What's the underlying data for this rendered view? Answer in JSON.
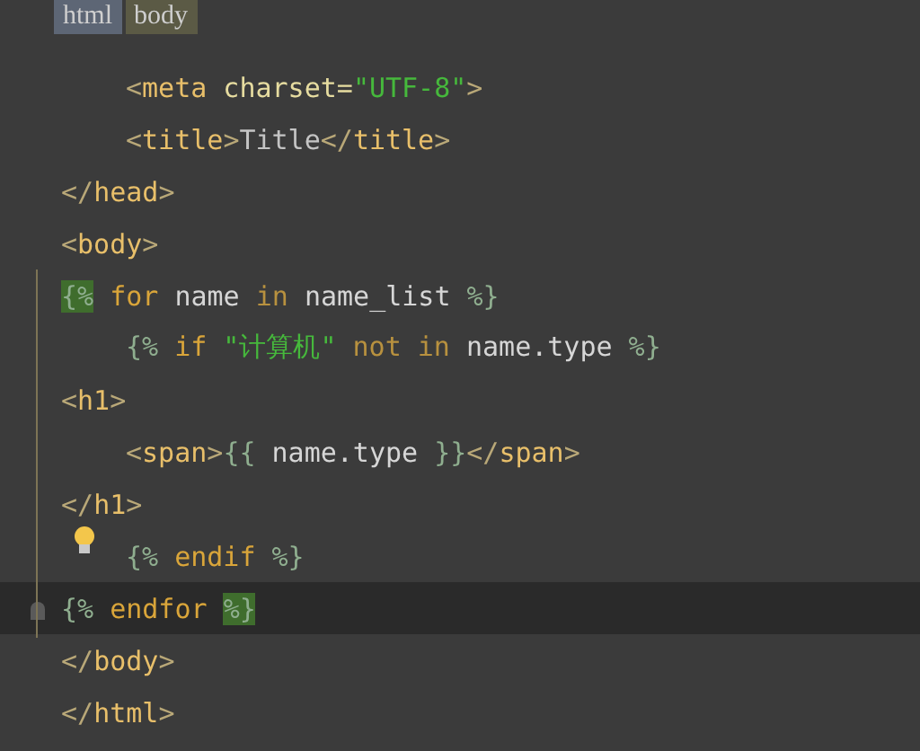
{
  "breadcrumb": [
    {
      "label": "html",
      "selected": false
    },
    {
      "label": "body",
      "selected": true
    }
  ],
  "lines": [
    {
      "indented": true,
      "current": false,
      "bulb": false,
      "tokens": [
        {
          "kind": "bracket",
          "text": "<"
        },
        {
          "kind": "tag",
          "text": "meta"
        },
        {
          "kind": "attr",
          "text": " charset="
        },
        {
          "kind": "string",
          "text": "\"UTF-8\""
        },
        {
          "kind": "bracket",
          "text": ">"
        }
      ]
    },
    {
      "indented": true,
      "current": false,
      "bulb": false,
      "tokens": [
        {
          "kind": "bracket",
          "text": "<"
        },
        {
          "kind": "tag",
          "text": "title"
        },
        {
          "kind": "bracket",
          "text": ">"
        },
        {
          "kind": "text",
          "text": "Title"
        },
        {
          "kind": "bracket",
          "text": "</"
        },
        {
          "kind": "tag",
          "text": "title"
        },
        {
          "kind": "bracket",
          "text": ">"
        }
      ]
    },
    {
      "indented": false,
      "current": false,
      "bulb": false,
      "tokens": [
        {
          "kind": "bracket",
          "text": "</"
        },
        {
          "kind": "tag",
          "text": "head"
        },
        {
          "kind": "bracket",
          "text": ">"
        }
      ]
    },
    {
      "indented": false,
      "current": false,
      "bulb": false,
      "tokens": [
        {
          "kind": "bracket",
          "text": "<"
        },
        {
          "kind": "tag",
          "text": "body"
        },
        {
          "kind": "bracket",
          "text": ">"
        }
      ]
    },
    {
      "indented": false,
      "current": false,
      "bulb": false,
      "tokens": [
        {
          "kind": "delim",
          "text": "{%",
          "matched": true
        },
        {
          "kind": "keyword",
          "text": " for"
        },
        {
          "kind": "ident",
          "text": " name"
        },
        {
          "kind": "op",
          "text": " in"
        },
        {
          "kind": "ident",
          "text": " name_list"
        },
        {
          "kind": "delim",
          "text": " %}",
          "matched": false
        }
      ]
    },
    {
      "indented": true,
      "current": false,
      "bulb": false,
      "tokens": [
        {
          "kind": "delim",
          "text": "{%",
          "matched": false
        },
        {
          "kind": "keyword",
          "text": " if"
        },
        {
          "kind": "string",
          "text": " \"计算机\""
        },
        {
          "kind": "op",
          "text": " not in"
        },
        {
          "kind": "ident",
          "text": " name.type"
        },
        {
          "kind": "delim",
          "text": " %}",
          "matched": false
        }
      ]
    },
    {
      "indented": false,
      "current": false,
      "bulb": false,
      "tokens": [
        {
          "kind": "bracket",
          "text": "<"
        },
        {
          "kind": "tag",
          "text": "h1"
        },
        {
          "kind": "bracket",
          "text": ">"
        }
      ]
    },
    {
      "indented": true,
      "current": false,
      "bulb": false,
      "tokens": [
        {
          "kind": "bracket",
          "text": "<"
        },
        {
          "kind": "tag",
          "text": "span"
        },
        {
          "kind": "bracket",
          "text": ">"
        },
        {
          "kind": "delim",
          "text": "{{",
          "matched": false
        },
        {
          "kind": "ident",
          "text": " name.type"
        },
        {
          "kind": "delim",
          "text": " }}",
          "matched": false
        },
        {
          "kind": "bracket",
          "text": "</"
        },
        {
          "kind": "tag",
          "text": "span"
        },
        {
          "kind": "bracket",
          "text": ">"
        }
      ]
    },
    {
      "indented": false,
      "current": false,
      "bulb": false,
      "tokens": [
        {
          "kind": "bracket",
          "text": "</"
        },
        {
          "kind": "tag",
          "text": "h1"
        },
        {
          "kind": "bracket",
          "text": ">"
        }
      ]
    },
    {
      "indented": true,
      "current": false,
      "bulb": true,
      "tokens": [
        {
          "kind": "delim",
          "text": "{%",
          "matched": false
        },
        {
          "kind": "keyword",
          "text": " endif"
        },
        {
          "kind": "delim",
          "text": " %}",
          "matched": false
        }
      ]
    },
    {
      "indented": false,
      "current": true,
      "bulb": false,
      "tokens": [
        {
          "kind": "delim",
          "text": "{%",
          "matched": false
        },
        {
          "kind": "keyword",
          "text": " endfor "
        },
        {
          "kind": "delim",
          "text": "%}",
          "matched": true
        }
      ]
    },
    {
      "indented": false,
      "current": false,
      "bulb": false,
      "tokens": [
        {
          "kind": "bracket",
          "text": "</"
        },
        {
          "kind": "tag",
          "text": "body"
        },
        {
          "kind": "bracket",
          "text": ">"
        }
      ]
    },
    {
      "indented": false,
      "current": false,
      "bulb": false,
      "tokens": [
        {
          "kind": "bracket",
          "text": "</"
        },
        {
          "kind": "tag",
          "text": "html"
        },
        {
          "kind": "bracket",
          "text": ">"
        }
      ]
    }
  ]
}
